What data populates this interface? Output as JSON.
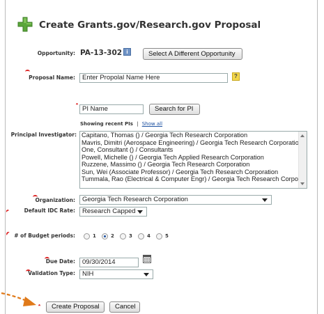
{
  "title": "Create Grants.gov/Research.gov Proposal",
  "icons": {
    "plus": "plus-icon",
    "info": "info-icon",
    "help": "help-icon",
    "calendar": "calendar-icon",
    "required": "required-marker-icon",
    "arrow": "pointer-arrow-icon"
  },
  "colors": {
    "plus_green": "#5aa63a",
    "link": "#1a4fa0",
    "required": "#dd2222",
    "arrow": "#e07a1a"
  },
  "opportunity": {
    "label": "Opportunity:",
    "value": "PA-13-302",
    "change_button": "Select A Different Opportunity"
  },
  "proposal_name": {
    "label": "Proposal Name:",
    "value": "Enter Propolal Name Here",
    "help": "?"
  },
  "pi_search": {
    "value": "PI Name",
    "button": "Search for PI",
    "recent_label": "Showing recent PIs",
    "separator": "|",
    "show_all": "Show all"
  },
  "principal_investigator": {
    "label": "Principal Investigator:",
    "options": [
      "Capitano, Thomas () / Georgia Tech Research Corporation",
      "Mavris, Dimitri (Aerospace Engineering) / Georgia Tech Research Corporation",
      "One, Consultant () / Consultants",
      "Powell, Michelle () / Georgia Tech Applied Research Corporation",
      "Ruzzene, Massimo () / Georgia Tech Research Corporation",
      "Sun, Wei (Associate Professor) / Georgia Tech Research Corporation",
      "Tummala, Rao (Electrical & Computer Engr) / Georgia Tech Research Corporation"
    ]
  },
  "organization": {
    "label": "Organization:",
    "value": "Georgia Tech Research Corporation"
  },
  "idc_rate": {
    "label": "Default IDC Rate:",
    "value": "Research Capped"
  },
  "budget_periods": {
    "label": "# of Budget periods:",
    "options": [
      "1",
      "2",
      "3",
      "4",
      "5"
    ],
    "selected": "2"
  },
  "due_date": {
    "label": "Due Date:",
    "value": "09/30/2014"
  },
  "validation_type": {
    "label": "Validation Type:",
    "value": "NIH"
  },
  "actions": {
    "create": "Create Proposal",
    "cancel": "Cancel"
  }
}
